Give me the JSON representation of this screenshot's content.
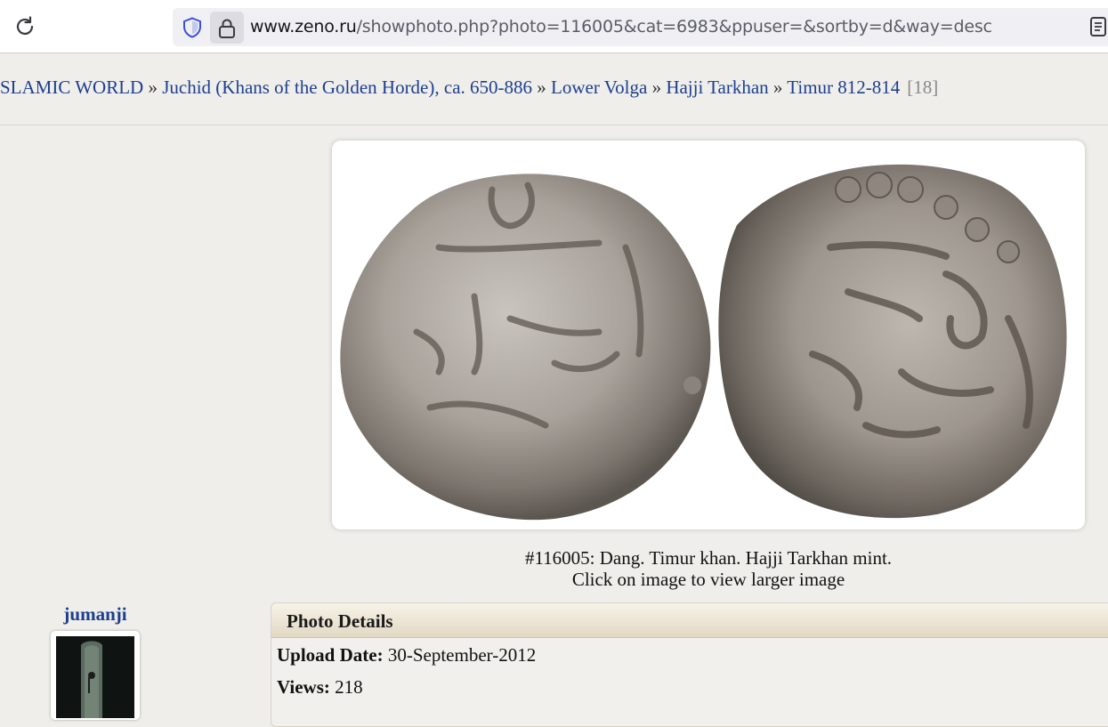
{
  "browser": {
    "url_host": "www.zeno.ru",
    "url_path": "/showphoto.php?photo=116005&cat=6983&ppuser=&sortby=d&way=desc",
    "icons": [
      "reload-icon",
      "shield-icon",
      "lock-icon",
      "reader-view-icon"
    ]
  },
  "breadcrumb": {
    "items": [
      "SLAMIC WORLD",
      "Juchid (Khans of the Golden Horde), ca. 650-886",
      "Lower Volga",
      "Hajji Tarkhan",
      "Timur 812-814"
    ],
    "separator": "»",
    "count": "[18]"
  },
  "photo": {
    "caption": "#116005: Dang. Timur khan. Hajji Tarkhan mint.",
    "hint": "Click on image to view larger image"
  },
  "user": {
    "name": "jumanji"
  },
  "details": {
    "title": "Photo Details",
    "upload_label": "Upload Date:",
    "upload_value": "30-September-2012",
    "views_label": "Views:",
    "views_value": "218"
  },
  "colors": {
    "link": "#1d3f8f",
    "page_bg": "#efeeea",
    "panel_header": "#e2d8c4"
  }
}
